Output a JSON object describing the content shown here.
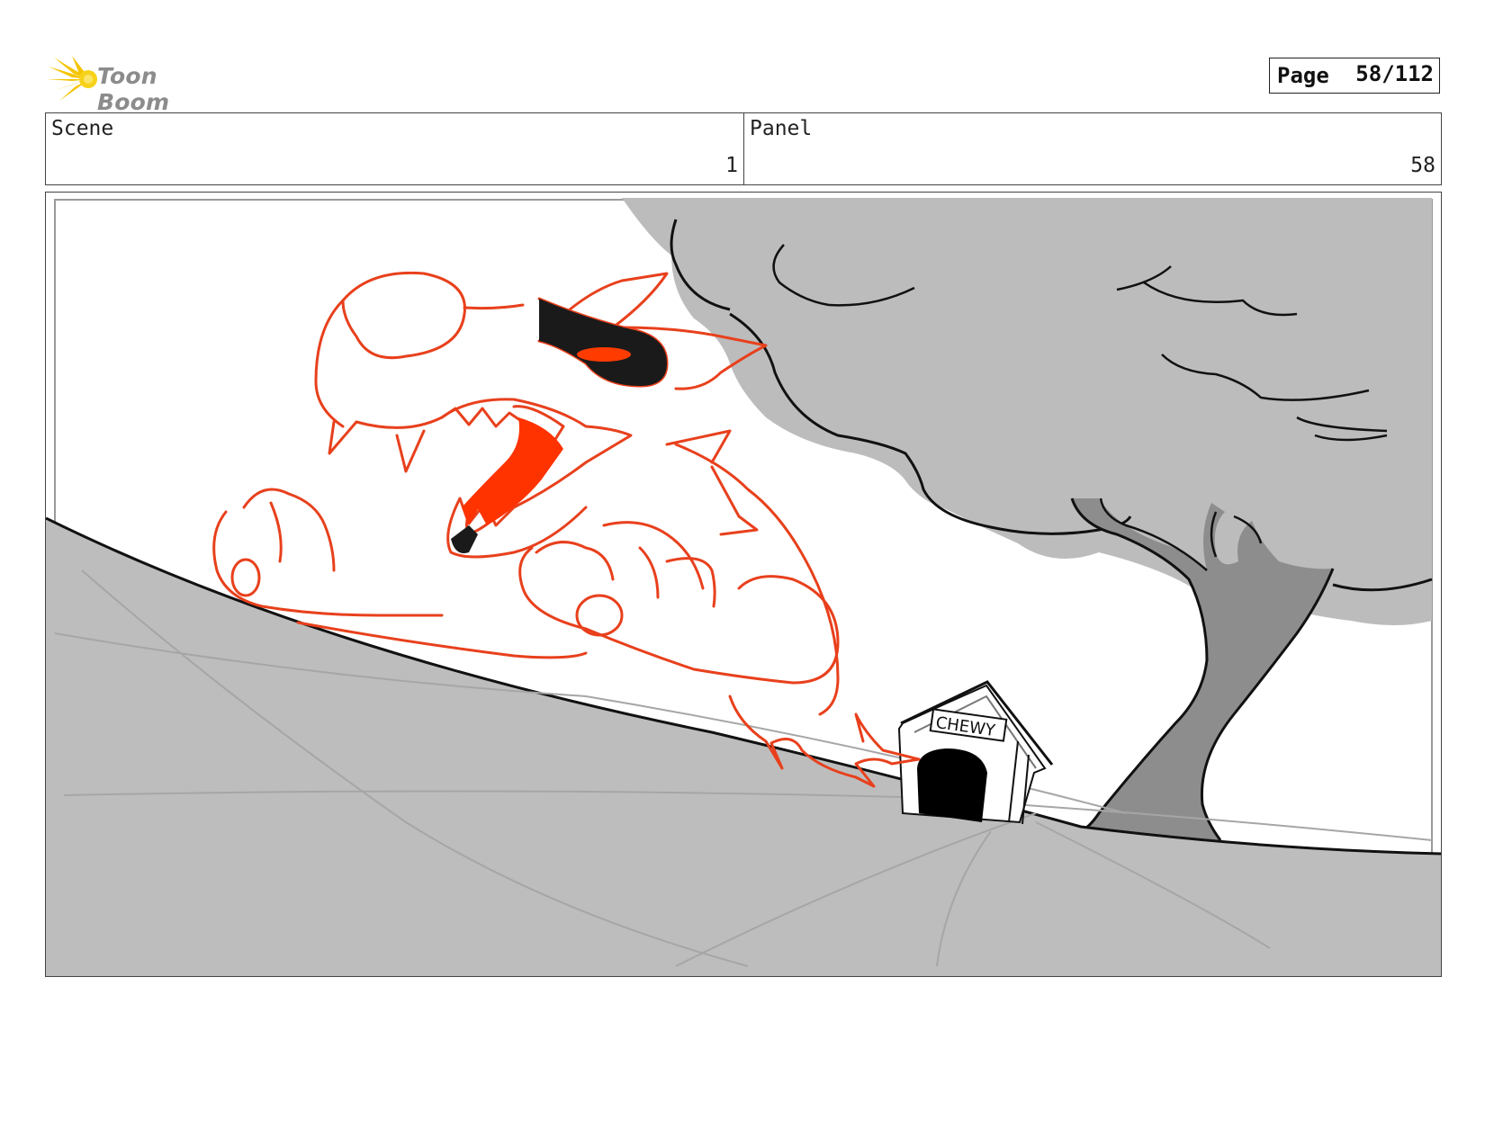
{
  "header": {
    "logo_text": "Toon Boom",
    "page_label": "Page",
    "page_value": "58/112"
  },
  "info": {
    "scene_label": "Scene",
    "scene_value": "1",
    "panel_label": "Panel",
    "panel_value": "58"
  },
  "drawing": {
    "doghouse_sign": "CHEWY"
  },
  "colors": {
    "sketch_red": "#e8401c",
    "ground_gray": "#bdbdbd",
    "tree_gray": "#b8b8b8",
    "trunk_gray": "#8a8a8a",
    "logo_yellow": "#f5c400"
  }
}
